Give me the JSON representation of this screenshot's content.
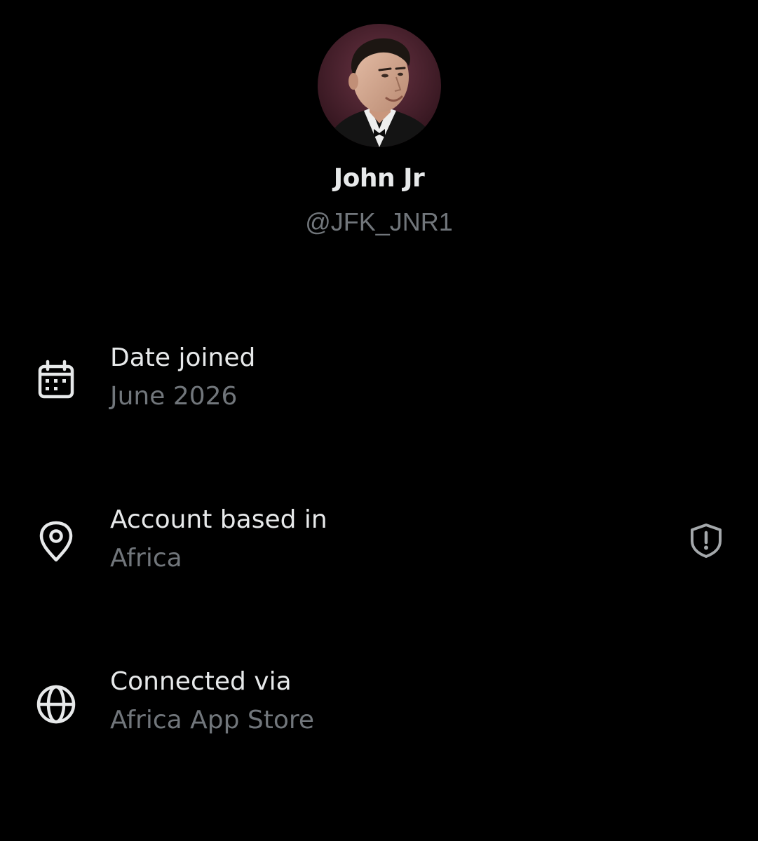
{
  "profile": {
    "display_name": "John Jr",
    "handle": "@JFK_JNR1",
    "avatar_icon": "profile-photo"
  },
  "about_rows": [
    {
      "icon": "calendar-icon",
      "label": "Date joined",
      "value": "June 2026"
    },
    {
      "icon": "location-pin-icon",
      "label": "Account based in",
      "value": "Africa",
      "trailing_icon": "shield-alert-icon"
    },
    {
      "icon": "globe-icon",
      "label": "Connected via",
      "value": "Africa App Store"
    }
  ],
  "colors": {
    "background": "#000000",
    "primary_text": "#e7e9ea",
    "secondary_text": "#71767b"
  }
}
